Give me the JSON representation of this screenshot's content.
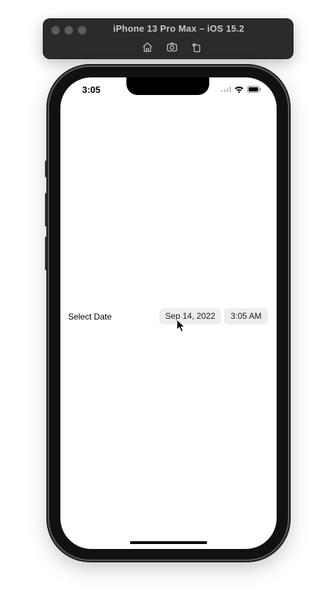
{
  "simulator": {
    "title": "iPhone 13 Pro Max – iOS 15.2",
    "toolbar": [
      {
        "name": "home",
        "icon": "home-icon"
      },
      {
        "name": "screenshot",
        "icon": "camera-icon"
      },
      {
        "name": "rotate",
        "icon": "rotate-icon"
      }
    ]
  },
  "status_bar": {
    "time": "3:05"
  },
  "date_picker": {
    "label": "Select Date",
    "date_value": "Sep 14, 2022",
    "time_value": "3:05 AM"
  },
  "colors": {
    "pill_background": "#eeeeef",
    "window_bar": "#2b2b2b",
    "phone_frame": "#111111"
  }
}
